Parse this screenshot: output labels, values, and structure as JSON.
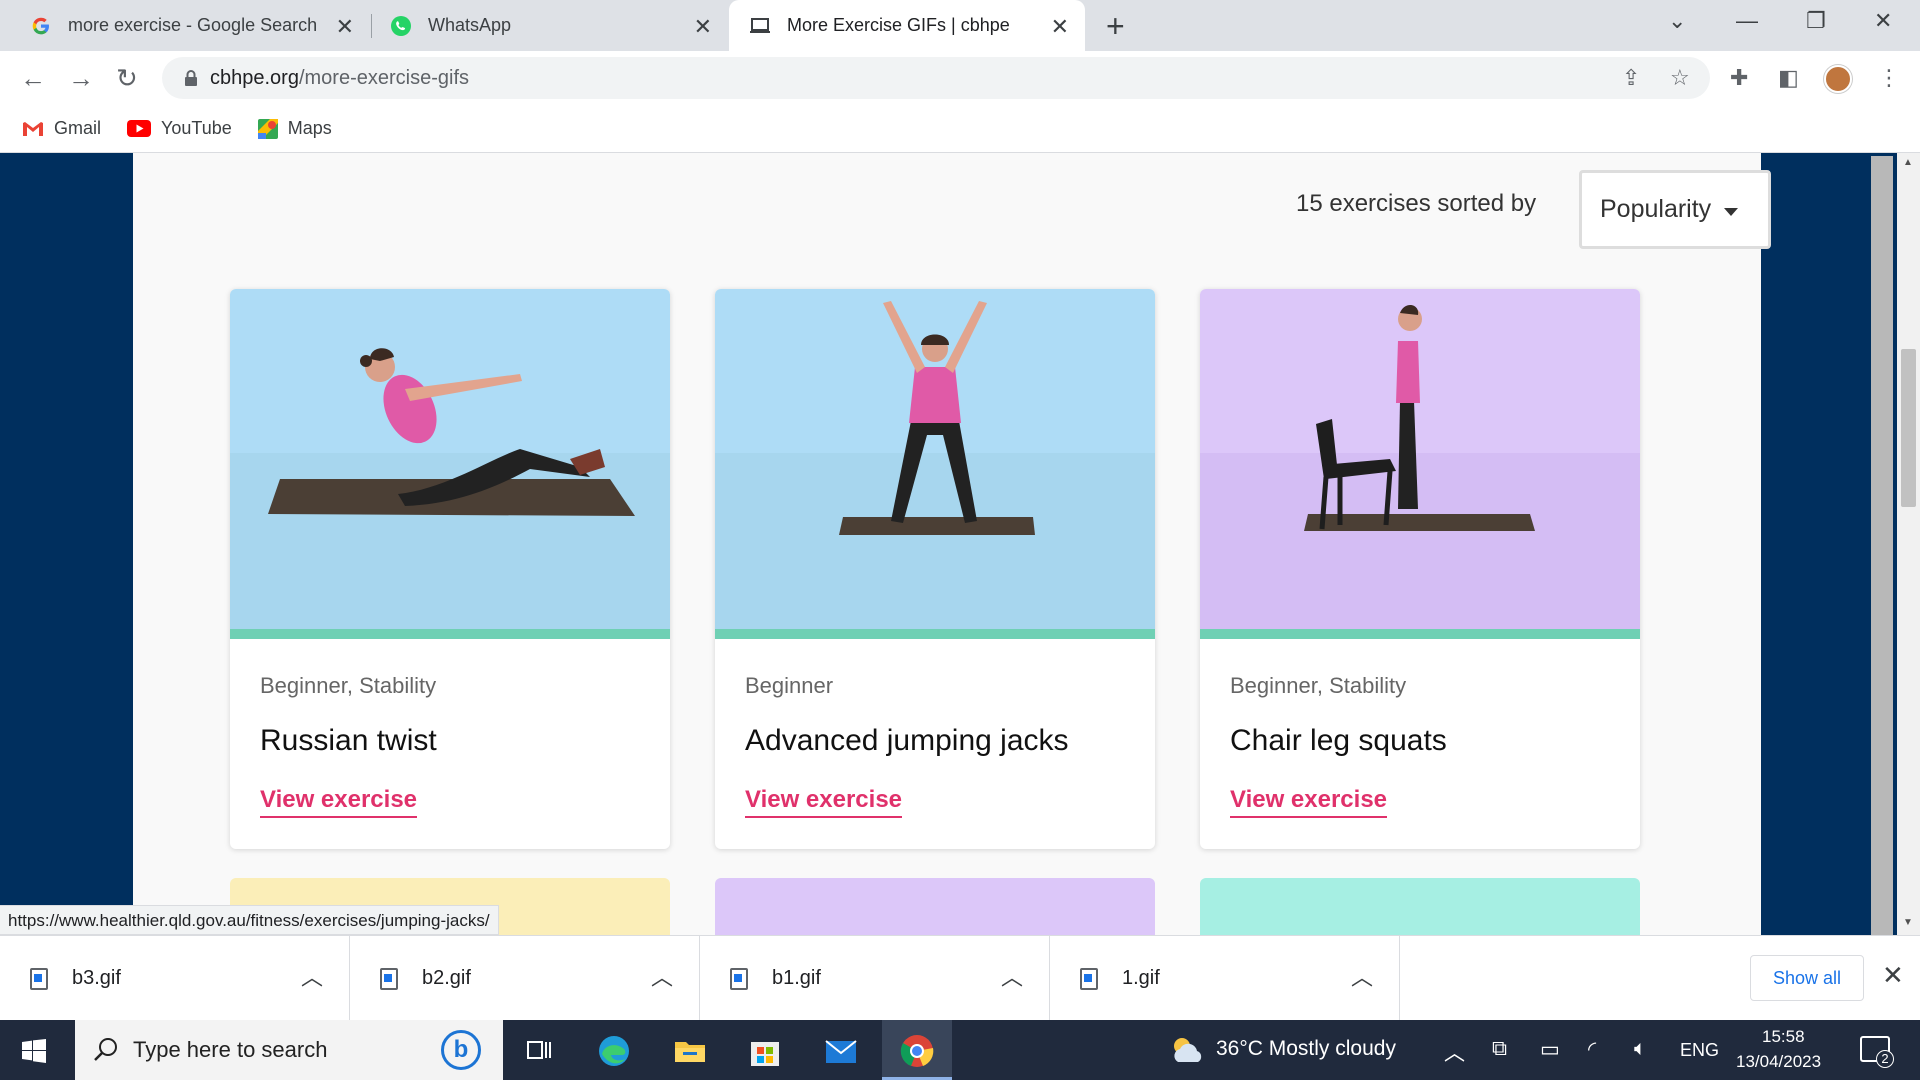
{
  "browser": {
    "tabs": [
      {
        "title": "more exercise - Google Search",
        "icon": "google-icon"
      },
      {
        "title": "WhatsApp",
        "icon": "whatsapp-icon"
      },
      {
        "title": "More Exercise GIFs | cbhpe",
        "icon": "laptop-icon",
        "active": true
      }
    ],
    "url_domain": "cbhpe.org",
    "url_path": "/more-exercise-gifs",
    "bookmarks": [
      {
        "label": "Gmail",
        "icon": "gmail-icon"
      },
      {
        "label": "YouTube",
        "icon": "youtube-icon"
      },
      {
        "label": "Maps",
        "icon": "maps-icon"
      }
    ],
    "status_url": "https://www.healthier.qld.gov.au/fitness/exercises/jumping-jacks/"
  },
  "page": {
    "sort_label": "15 exercises sorted by",
    "sort_value": "Popularity",
    "cards": [
      {
        "tags": "Beginner, Stability",
        "title": "Russian twist",
        "link": "View exercise",
        "color": "blue"
      },
      {
        "tags": "Beginner",
        "title": "Advanced jumping jacks",
        "link": "View exercise",
        "color": "blue"
      },
      {
        "tags": "Beginner, Stability",
        "title": "Chair leg squats",
        "link": "View exercise",
        "color": "purple"
      }
    ],
    "partial_card_colors": [
      "#fbeeb8",
      "#dcc7f9",
      "#a6efe3"
    ],
    "accent_color": "#6fd0b4",
    "link_color": "#e0316b"
  },
  "downloads": {
    "files": [
      "b3.gif",
      "b2.gif",
      "b1.gif",
      "1.gif"
    ],
    "show_all": "Show all"
  },
  "taskbar": {
    "search_placeholder": "Type here to search",
    "weather": "36°C  Mostly cloudy",
    "language": "ENG",
    "time": "15:58",
    "date": "13/04/2023",
    "notifications": "2"
  }
}
